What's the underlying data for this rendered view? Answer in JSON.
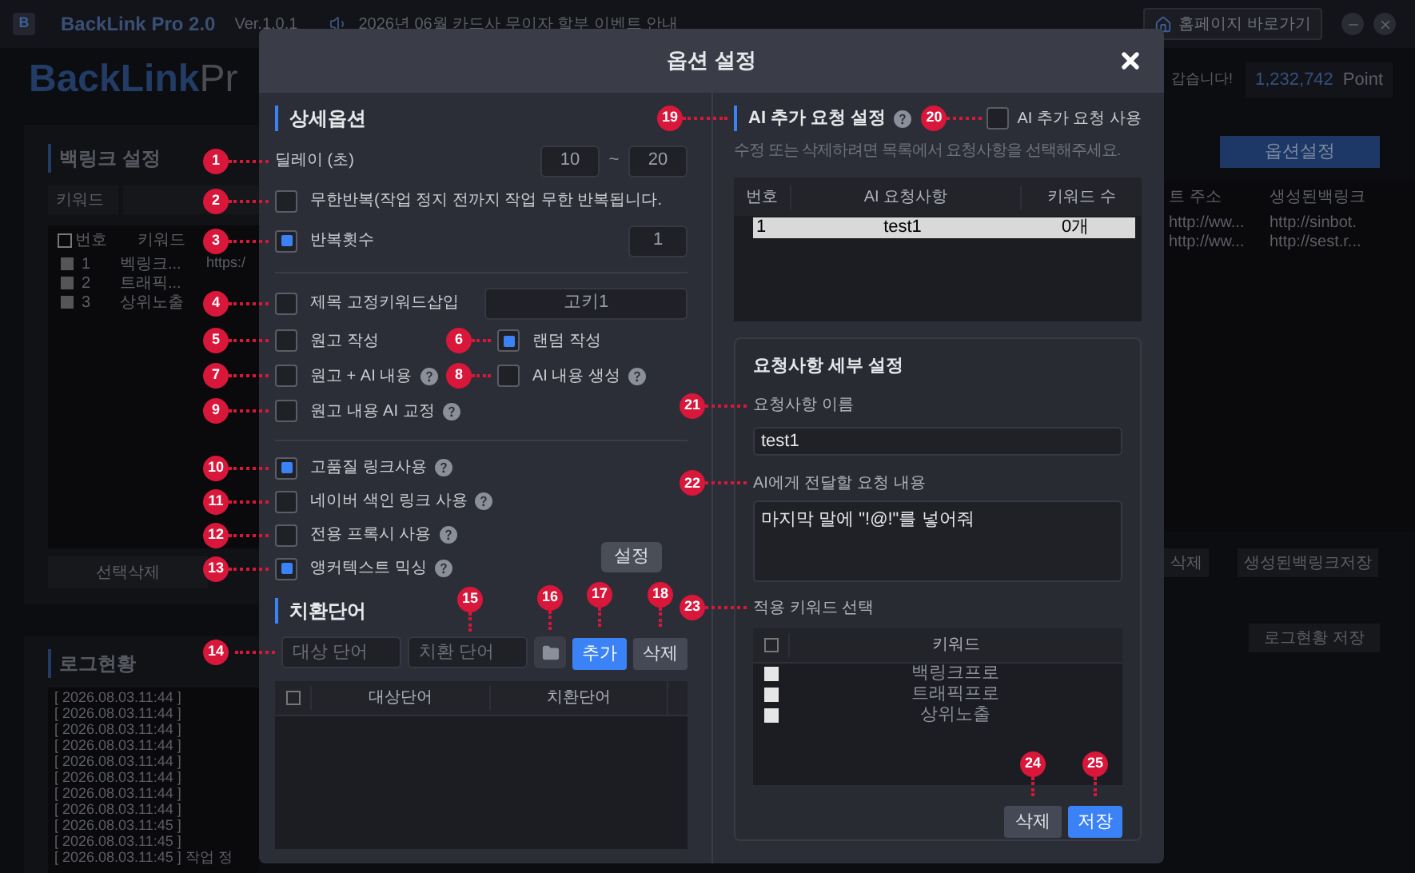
{
  "app": {
    "logo": "B",
    "name": "BackLink Pro 2.0",
    "version": "Ver.1.0.1",
    "notice": "2026년 06월 카드사 무이자 할부 이벤트 안내",
    "homepage_button": "홈페이지 바로가기",
    "brand_a": "BackLink",
    "brand_b": "Pr",
    "greeting": "갑습니다!",
    "points": "1,232,742",
    "points_unit": "Point"
  },
  "backlink_panel": {
    "title": "백링크 설정",
    "keyword_label": "키워드",
    "all_checked": false,
    "columns": [
      "번호",
      "키워드"
    ],
    "rows": [
      {
        "checked": false,
        "number": "1",
        "keyword": "벡링크...",
        "url": "https:/"
      },
      {
        "checked": false,
        "number": "2",
        "keyword": "트래픽..."
      },
      {
        "checked": false,
        "number": "3",
        "keyword": "상위노출"
      }
    ],
    "delete_button": "선택삭제"
  },
  "log_panel": {
    "title": "로그현황",
    "lines": [
      {
        "time": "[ 2026.08.03.11:44 ]"
      },
      {
        "time": "[ 2026.08.03.11:44 ]"
      },
      {
        "time": "[ 2026.08.03.11:44 ]"
      },
      {
        "time": "[ 2026.08.03.11:44 ]"
      },
      {
        "time": "[ 2026.08.03.11:44 ]"
      },
      {
        "time": "[ 2026.08.03.11:44 ]"
      },
      {
        "time": "[ 2026.08.03.11:44 ]"
      },
      {
        "time": "[ 2026.08.03.11:44 ]"
      },
      {
        "time": "[ 2026.08.03.11:45 ]"
      },
      {
        "time": "[ 2026.08.03.11:45 ]"
      },
      {
        "time": "[ 2026.08.03.11:45 ]",
        "message": "작업 정"
      }
    ]
  },
  "right_panel": {
    "option_button": "옵션설정",
    "columns": [
      "트 주소",
      "생성된백링크"
    ],
    "rows": [
      [
        "http://ww...",
        "http://sinbot."
      ],
      [
        "http://ww...",
        "http://sest.r..."
      ]
    ],
    "delete_button": "삭제",
    "save_button": "생성된백링크저장",
    "log_save_button": "로그현황 저장"
  },
  "dialog": {
    "title": "옵션 설정",
    "detail": {
      "title": "상세옵션",
      "groups": [
        [
          {
            "kind": "range",
            "callout": "1",
            "label": "딜레이 (초)",
            "from": "10",
            "separator": "~",
            "to": "20"
          },
          {
            "kind": "checkbox",
            "callout": "2",
            "label": "무한반복(작업 정지 전까지 작업 무한 반복됩니다.",
            "checked": false
          },
          {
            "kind": "count",
            "callout": "3",
            "label": "반복횟수",
            "checked": true,
            "value": "1"
          }
        ],
        [
          {
            "kind": "input",
            "callout": "4",
            "label": "제목 고정키워드삽입",
            "checked": false,
            "value": "고키1"
          },
          {
            "kind": "pair",
            "items": [
              {
                "callout": "5",
                "label": "원고 작성",
                "checked": false
              },
              {
                "callout": "6",
                "label": "랜덤 작성",
                "checked": true
              }
            ]
          },
          {
            "kind": "pair",
            "items": [
              {
                "callout": "7",
                "label": "원고 + AI 내용",
                "checked": false,
                "help": true
              },
              {
                "callout": "8",
                "label": "AI 내용 생성",
                "checked": false,
                "help": true
              }
            ]
          },
          {
            "kind": "checkbox",
            "callout": "9",
            "label": "원고 내용 AI 교정",
            "checked": false,
            "help": true
          }
        ],
        [
          {
            "kind": "checkbox",
            "callout": "10",
            "label": "고품질 링크사용",
            "checked": true,
            "help": true
          },
          {
            "kind": "checkbox",
            "callout": "11",
            "label": "네이버 색인 링크 사용",
            "checked": false,
            "help": true
          },
          {
            "kind": "checkbox",
            "callout": "12",
            "label": "전용 프록시 사용",
            "checked": false,
            "help": true
          },
          {
            "kind": "checkbox",
            "callout": "13",
            "label": "앵커텍스트 믹싱",
            "checked": true,
            "help": true,
            "button": "설정"
          }
        ]
      ]
    },
    "replace": {
      "title": "치환단어",
      "callout": "14",
      "target_placeholder": "대상 단어",
      "replace_placeholder": "치환 단어",
      "replace_callout": "15",
      "folder_callout": "16",
      "add_button": "추가",
      "add_callout": "17",
      "delete_button": "삭제",
      "delete_callout": "18",
      "all_checked": false,
      "columns": [
        "대상단어",
        "치환단어"
      ]
    },
    "ai": {
      "callout": "19",
      "title": "AI 추가 요청 설정",
      "use_callout": "20",
      "use_label": "AI 추가 요청 사용",
      "use_checked": false,
      "hint": "수정 또는 삭제하려면 목록에서 요청사항을 선택해주세요.",
      "columns": [
        "번호",
        "AI 요청사항",
        "키워드 수"
      ],
      "rows": [
        {
          "number": "1",
          "request": "test1",
          "count": "0개",
          "selected": true
        }
      ],
      "detail": {
        "title": "요청사항 세부 설정",
        "name_callout": "21",
        "name_label": "요청사항 이름",
        "name_value": "test1",
        "content_callout": "22",
        "content_label": "AI에게 전달할 요청 내용",
        "content_value": "마지막 말에 \"!@!\"를 넣어줘",
        "keywords_callout": "23",
        "keywords_label": "적용 키워드 선택",
        "keywords_all_checked": false,
        "keyword_column": "키워드",
        "keywords": [
          {
            "label": "백링크프로",
            "checked": false
          },
          {
            "label": "트래픽프로",
            "checked": false
          },
          {
            "label": "상위노출",
            "checked": false
          }
        ],
        "delete_callout": "24",
        "delete_button": "삭제",
        "save_callout": "25",
        "save_button": "저장"
      }
    }
  }
}
